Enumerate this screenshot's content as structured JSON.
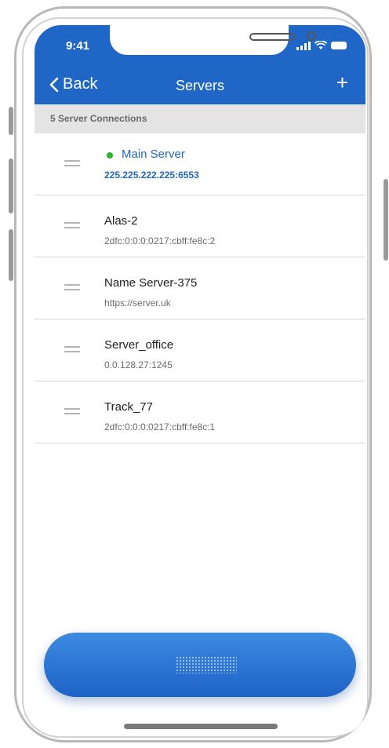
{
  "status_bar": {
    "time": "9:41"
  },
  "nav": {
    "back_label": "Back",
    "title": "Servers",
    "add_label": "+"
  },
  "section": {
    "label": "5 Server Connections"
  },
  "servers": [
    {
      "name": "Main Server",
      "address": "225.225.222.225:6553",
      "active": true
    },
    {
      "name": "Alas-2",
      "address": "2dfc:0:0:0:0217:cbff:fe8c:2",
      "active": false
    },
    {
      "name": "Name Server-375",
      "address": "https://server.uk",
      "active": false
    },
    {
      "name": "Server_office",
      "address": "0.0.128.27:1245",
      "active": false
    },
    {
      "name": "Track_77",
      "address": "2dfc:0:0:0:0217:cbff:fe8c:1",
      "active": false
    }
  ],
  "colors": {
    "brand": "#1f66c6",
    "online": "#2cb32c"
  }
}
